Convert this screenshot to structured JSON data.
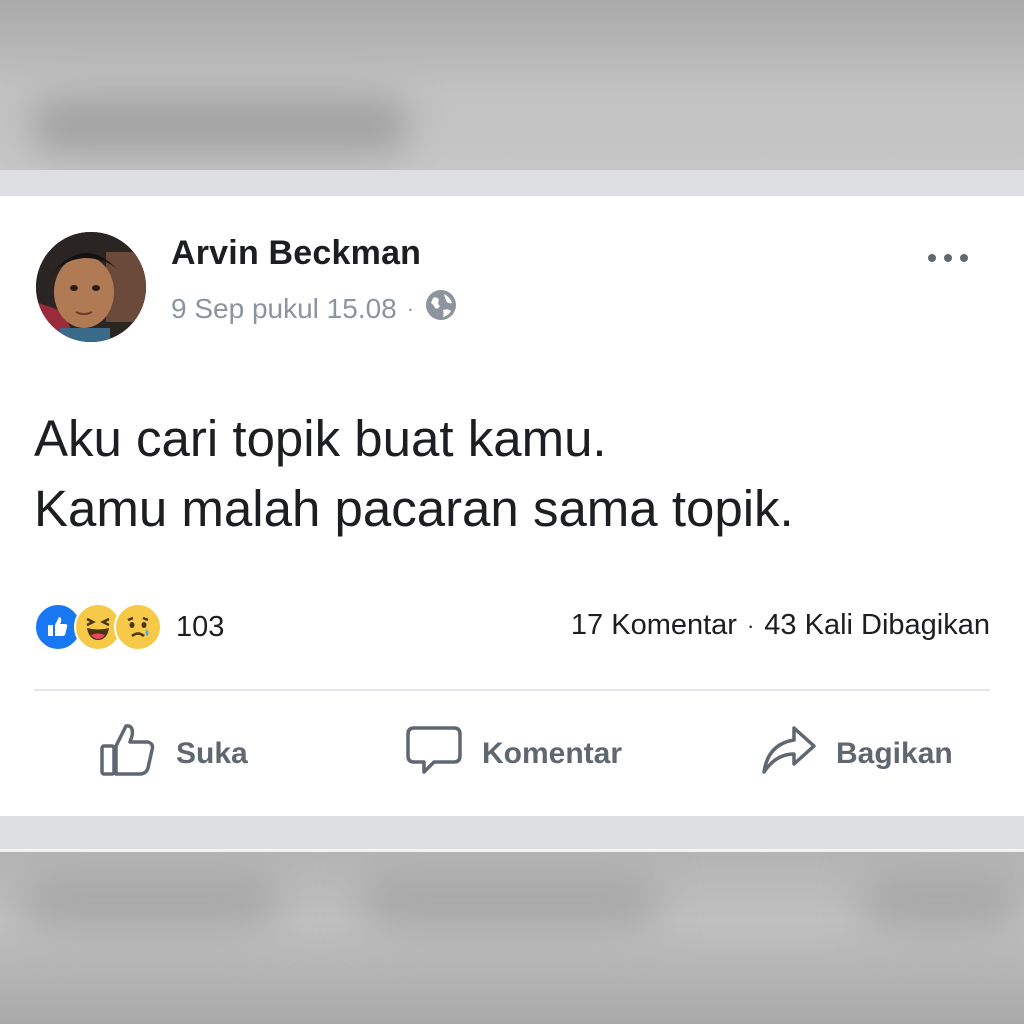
{
  "post": {
    "author": "Arvin Beckman",
    "timestamp": "9 Sep pukul 15.08",
    "separator": "·",
    "privacy_icon": "globe-icon",
    "text_lines": [
      "Aku cari topik buat kamu.",
      "Kamu malah pacaran sama topik."
    ],
    "more_icon": "more-options-icon"
  },
  "reactions": {
    "icons": [
      "like-reaction-icon",
      "haha-reaction-icon",
      "sad-reaction-icon"
    ],
    "count": "103"
  },
  "stats": {
    "comments": "17 Komentar",
    "separator": "·",
    "shares": "43 Kali Dibagikan"
  },
  "actions": {
    "like_label": "Suka",
    "comment_label": "Komentar",
    "share_label": "Bagikan"
  },
  "colors": {
    "like_blue": "#1877f2",
    "emoji_yellow": "#f7c948",
    "action_gray": "#606770",
    "meta_gray": "#8d949e"
  }
}
